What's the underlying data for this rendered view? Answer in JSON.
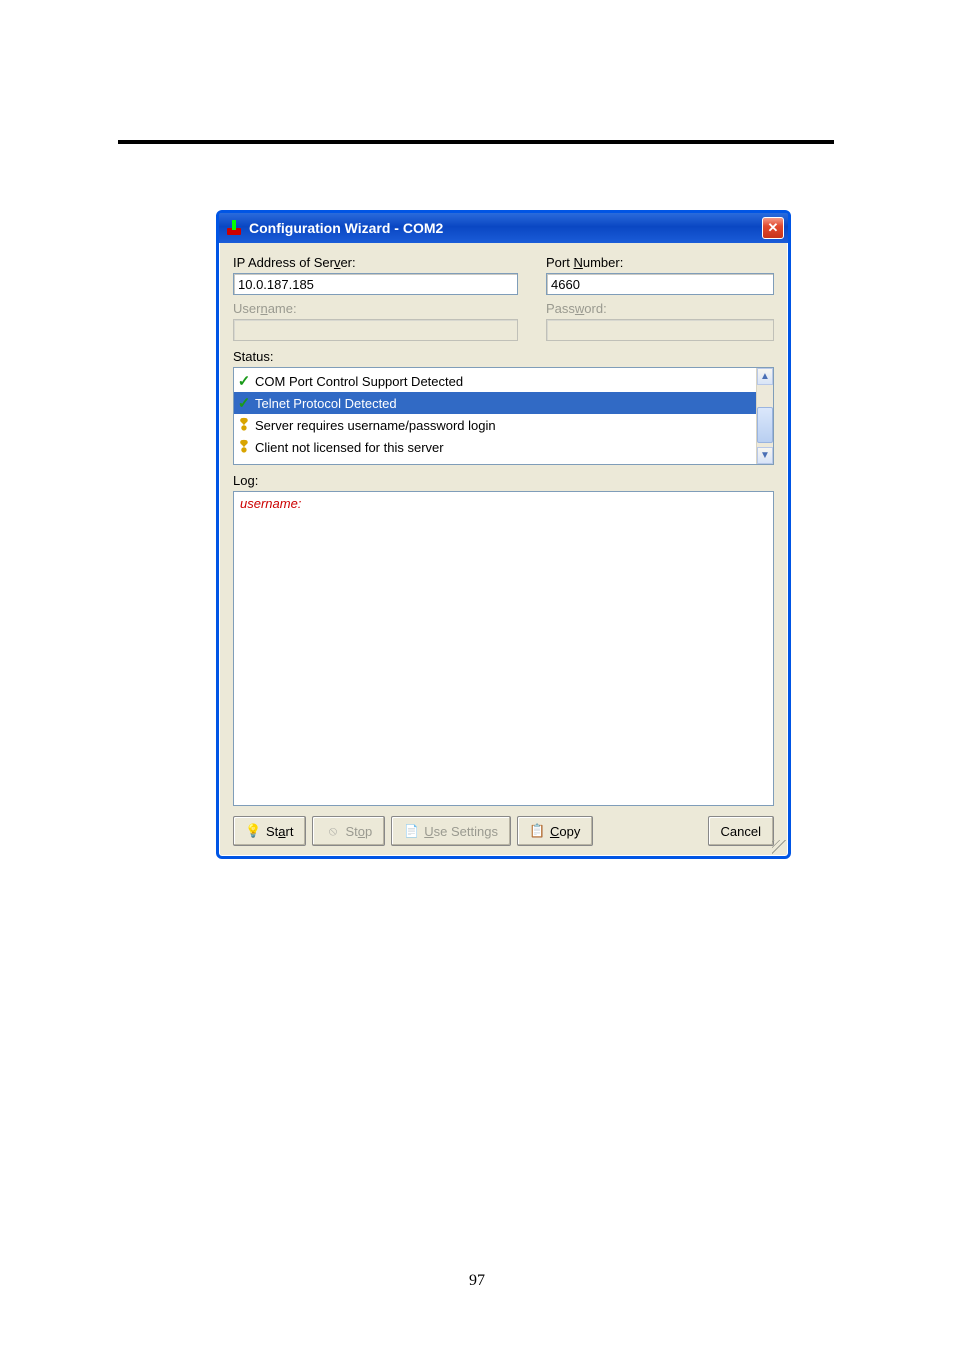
{
  "page_number": "97",
  "window": {
    "title": "Configuration Wizard - COM2"
  },
  "fields": {
    "ip_label_pre": "IP Address of Ser",
    "ip_label_ak": "v",
    "ip_label_post": "er:",
    "ip_value": "10.0.187.185",
    "port_label_pre": "Port ",
    "port_label_ak": "N",
    "port_label_post": "umber:",
    "port_value": "4660",
    "user_label_pre": "User",
    "user_label_ak": "n",
    "user_label_post": "ame:",
    "user_value": "",
    "pass_label_pre": "Pass",
    "pass_label_ak": "w",
    "pass_label_post": "ord:",
    "pass_value": ""
  },
  "status": {
    "label": "Status:",
    "items": [
      {
        "icon": "check",
        "text": "COM Port Control Support Detected",
        "selected": false
      },
      {
        "icon": "check",
        "text": "Telnet Protocol Detected",
        "selected": true
      },
      {
        "icon": "excl",
        "text": "Server requires username/password login",
        "selected": false
      },
      {
        "icon": "excl",
        "text": "Client not licensed for this server",
        "selected": false
      }
    ]
  },
  "log": {
    "label": "Log:",
    "content": "username:"
  },
  "buttons": {
    "start_pre": "St",
    "start_ak": "a",
    "start_post": "rt",
    "stop_pre": "St",
    "stop_ak": "o",
    "stop_post": "p",
    "use_ak": "U",
    "use_post": "se Settings",
    "copy_ak": "C",
    "copy_post": "opy",
    "cancel": "Cancel"
  }
}
